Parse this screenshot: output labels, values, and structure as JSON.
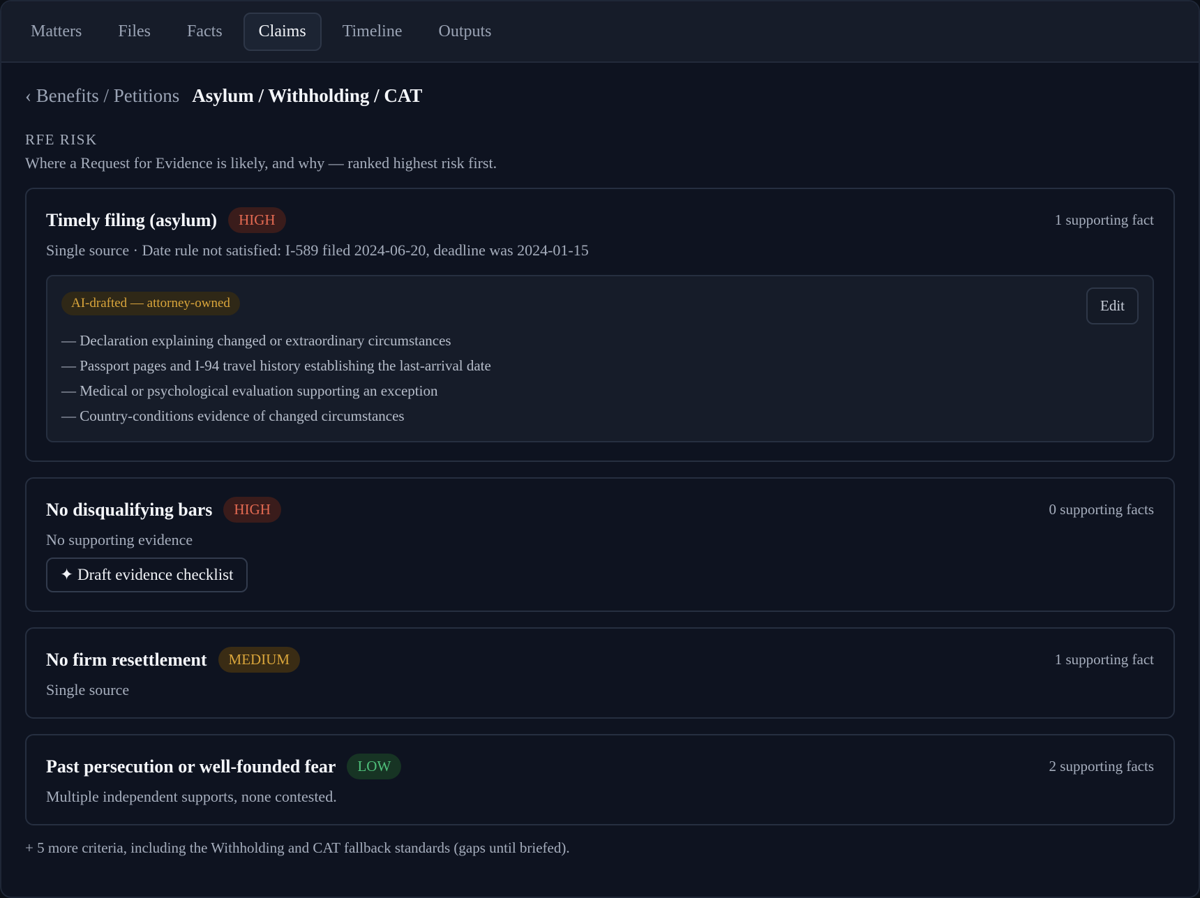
{
  "nav": {
    "tabs": [
      {
        "label": "Matters"
      },
      {
        "label": "Files"
      },
      {
        "label": "Facts"
      },
      {
        "label": "Claims"
      },
      {
        "label": "Timeline"
      },
      {
        "label": "Outputs"
      }
    ],
    "active": "Claims"
  },
  "breadcrumb": {
    "back": "‹ Benefits / Petitions",
    "current": "Asylum / Withholding / CAT"
  },
  "section": {
    "label": "RFE RISK",
    "description": "Where a Request for Evidence is likely, and why — ranked highest risk first."
  },
  "cards": [
    {
      "title": "Timely filing (asylum)",
      "risk": "HIGH",
      "support": "1 supporting fact",
      "subtitle": "Single source · Date rule not satisfied: I-589 filed 2024-06-20, deadline was 2024-01-15",
      "draft": {
        "chip": "AI-drafted — attorney-owned",
        "edit_label": "Edit",
        "items": [
          "— Declaration explaining changed or extraordinary circumstances",
          "— Passport pages and I-94 travel history establishing the last-arrival date",
          "— Medical or psychological evaluation supporting an exception",
          "— Country-conditions evidence of changed circumstances"
        ]
      }
    },
    {
      "title": "No disqualifying bars",
      "risk": "HIGH",
      "support": "0 supporting facts",
      "subtitle": "No supporting evidence",
      "action_label": "✦ Draft evidence checklist"
    },
    {
      "title": "No firm resettlement",
      "risk": "MEDIUM",
      "support": "1 supporting fact",
      "subtitle": "Single source"
    },
    {
      "title": "Past persecution or well-founded fear",
      "risk": "LOW",
      "support": "2 supporting facts",
      "subtitle": "Multiple independent supports, none contested."
    }
  ],
  "footer": "+ 5 more criteria, including the Withholding and CAT fallback standards (gaps until briefed).",
  "colors": {
    "high": "#e46a52",
    "medium": "#d9a53b",
    "low": "#4fbf7a",
    "background": "#0e1320"
  }
}
